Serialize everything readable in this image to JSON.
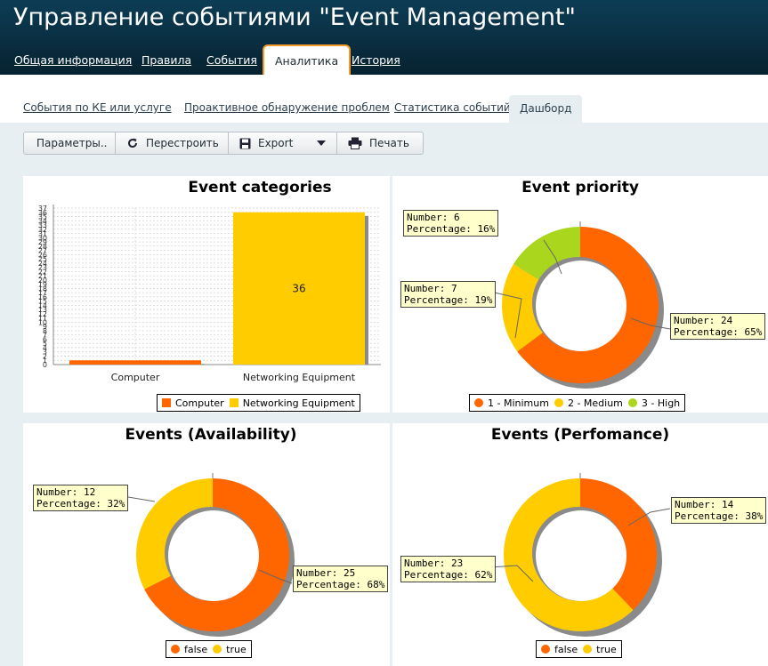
{
  "app": {
    "title": "Управление событиями \"Event Management\""
  },
  "main_tabs": [
    {
      "label": "Общая информация"
    },
    {
      "label": "Правила"
    },
    {
      "label": "События"
    },
    {
      "label": "Аналитика",
      "active": true
    },
    {
      "label": "История"
    }
  ],
  "sub_tabs": [
    {
      "label": "События по КЕ или услуге"
    },
    {
      "label": "Проактивное обнаружение проблем"
    },
    {
      "label": "Статистика событий"
    },
    {
      "label": "Дашборд",
      "active": true
    }
  ],
  "toolbar": {
    "params_label": "Параметры..",
    "rebuild_label": "Перестроить",
    "export_label": "Export",
    "print_label": "Печать"
  },
  "colors": {
    "orange": "#ff6600",
    "yellow": "#ffcc00",
    "green": "#aad71e",
    "accent_tab": "#f29b2c"
  },
  "chart_data": [
    {
      "type": "bar",
      "title": "Event categories",
      "categories": [
        "Computer",
        "Networking Equipment"
      ],
      "values": [
        1,
        36
      ],
      "data_labels": [
        "",
        "36"
      ],
      "ylim": [
        0,
        37
      ],
      "yticks": [
        0,
        1,
        2,
        3,
        4,
        5,
        6,
        7,
        8,
        9,
        10,
        11,
        12,
        13,
        14,
        15,
        16,
        17,
        18,
        19,
        20,
        21,
        22,
        23,
        24,
        25,
        26,
        27,
        28,
        29,
        30,
        31,
        32,
        33,
        34,
        35,
        36,
        37
      ],
      "grid": true,
      "legend": [
        "Computer",
        "Networking Equipment"
      ],
      "legend_placement": "bottom-right"
    },
    {
      "type": "pie",
      "title": "Event priority",
      "series": [
        {
          "name": "1 - Minimum",
          "value": 24,
          "percent": 65,
          "tip_number": "Number: 24",
          "tip_percent": "Percentage: 65%"
        },
        {
          "name": "2 - Medium",
          "value": 7,
          "percent": 19,
          "tip_number": "Number: 7",
          "tip_percent": "Percentage: 19%"
        },
        {
          "name": "3 - High",
          "value": 6,
          "percent": 16,
          "tip_number": "Number: 6",
          "tip_percent": "Percentage: 16%"
        }
      ],
      "legend_placement": "bottom"
    },
    {
      "type": "pie",
      "title": "Events (Availability)",
      "series": [
        {
          "name": "false",
          "value": 25,
          "percent": 68,
          "tip_number": "Number: 25",
          "tip_percent": "Percentage: 68%"
        },
        {
          "name": "true",
          "value": 12,
          "percent": 32,
          "tip_number": "Number: 12",
          "tip_percent": "Percentage: 32%"
        }
      ],
      "legend_placement": "bottom"
    },
    {
      "type": "pie",
      "title": "Events (Perfomance)",
      "series": [
        {
          "name": "false",
          "value": 14,
          "percent": 38,
          "tip_number": "Number: 14",
          "tip_percent": "Percentage: 38%"
        },
        {
          "name": "true",
          "value": 23,
          "percent": 62,
          "tip_number": "Number: 23",
          "tip_percent": "Percentage: 62%"
        }
      ],
      "legend_placement": "bottom"
    }
  ]
}
